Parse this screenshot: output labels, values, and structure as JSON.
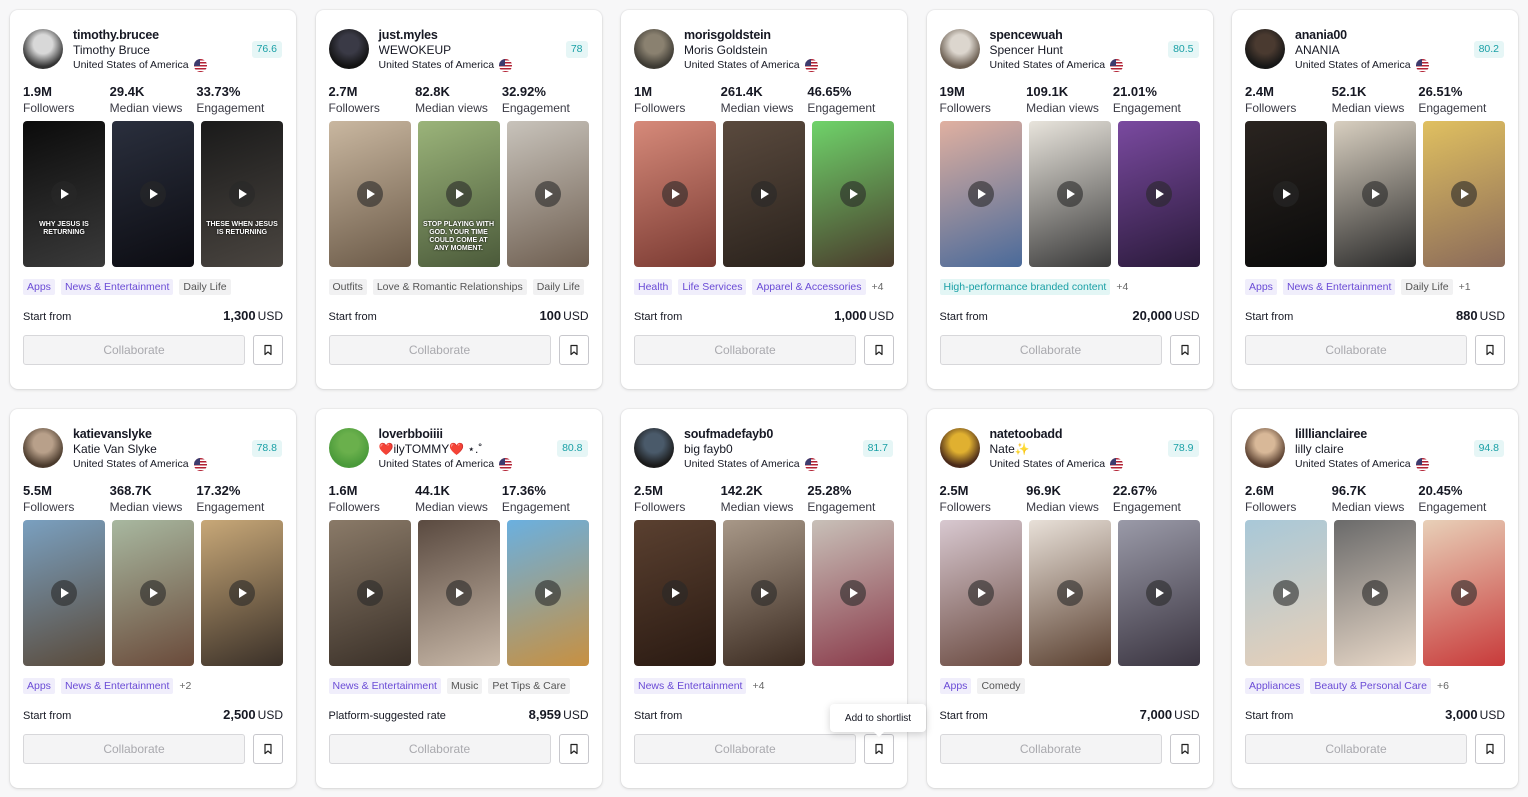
{
  "cards": [
    {
      "handle": "timothy.brucee",
      "display_name": "Timothy Bruce",
      "country": "United States of America",
      "score": "76.6",
      "followers": "1.9M",
      "median_views": "29.4K",
      "engagement": "33.73%",
      "followers_label": "Followers",
      "views_label": "Median views",
      "engagement_label": "Engagement",
      "tags": [
        {
          "text": "Apps",
          "style": "p"
        },
        {
          "text": "News & Entertainment",
          "style": "p"
        },
        {
          "text": "Daily Life",
          "style": "g"
        }
      ],
      "price_label": "Start from",
      "price": "1,300",
      "currency": "USD",
      "collaborate_label": "Collaborate",
      "avatar_colors": [
        "#d8d8d8",
        "#333333"
      ],
      "videos": [
        {
          "colors": [
            "#0b0b0b",
            "#3a3a3a"
          ],
          "caption": "WHY JESUS IS RETURNING"
        },
        {
          "colors": [
            "#2a2f3d",
            "#0c0c12"
          ],
          "caption": ""
        },
        {
          "colors": [
            "#1a1a1a",
            "#4a4540"
          ],
          "caption": "THESE WHEN JESUS IS RETURNING"
        }
      ]
    },
    {
      "handle": "just.myles",
      "display_name": "WEWOKEUP",
      "country": "United States of America",
      "score": "78",
      "followers": "2.7M",
      "median_views": "82.8K",
      "engagement": "32.92%",
      "followers_label": "Followers",
      "views_label": "Median views",
      "engagement_label": "Engagement",
      "tags": [
        {
          "text": "Outfits",
          "style": "g"
        },
        {
          "text": "Love & Romantic Relationships",
          "style": "g"
        },
        {
          "text": "Daily Life",
          "style": "g"
        }
      ],
      "price_label": "Start from",
      "price": "100",
      "currency": "USD",
      "collaborate_label": "Collaborate",
      "avatar_colors": [
        "#3a3a46",
        "#121212"
      ],
      "videos": [
        {
          "colors": [
            "#c9b7a0",
            "#6b5a48"
          ],
          "caption": ""
        },
        {
          "colors": [
            "#9bb47a",
            "#4b5a3a"
          ],
          "caption": "STOP PLAYING WITH GOD. YOUR TIME COULD COME AT ANY MOMENT."
        },
        {
          "colors": [
            "#c8c3bb",
            "#6e5e50"
          ],
          "caption": ""
        }
      ]
    },
    {
      "handle": "morisgoldstein",
      "display_name": "Moris  Goldstein",
      "country": "United States of America",
      "score": "",
      "followers": "1M",
      "median_views": "261.4K",
      "engagement": "46.65%",
      "followers_label": "Followers",
      "views_label": "Median views",
      "engagement_label": "Engagement",
      "tags": [
        {
          "text": "Health",
          "style": "p"
        },
        {
          "text": "Life Services",
          "style": "p"
        },
        {
          "text": "Apparel & Accessories",
          "style": "p"
        },
        {
          "text": "+4",
          "style": "more"
        }
      ],
      "price_label": "Start from",
      "price": "1,000",
      "currency": "USD",
      "collaborate_label": "Collaborate",
      "avatar_colors": [
        "#8a8170",
        "#3d3a33"
      ],
      "videos": [
        {
          "colors": [
            "#d68a7a",
            "#7a3a32"
          ],
          "caption": ""
        },
        {
          "colors": [
            "#5a4a3e",
            "#2a221c"
          ],
          "caption": ""
        },
        {
          "colors": [
            "#6fd36a",
            "#4a3a2c"
          ],
          "caption": ""
        }
      ]
    },
    {
      "handle": "spencewuah",
      "display_name": "Spencer Hunt",
      "country": "United States of America",
      "score": "80.5",
      "followers": "19M",
      "median_views": "109.1K",
      "engagement": "21.01%",
      "followers_label": "Followers",
      "views_label": "Median views",
      "engagement_label": "Engagement",
      "tags": [
        {
          "text": "High-performance branded content",
          "style": "t"
        },
        {
          "text": "+4",
          "style": "more"
        }
      ],
      "price_label": "Start from",
      "price": "20,000",
      "currency": "USD",
      "collaborate_label": "Collaborate",
      "avatar_colors": [
        "#dcd6ce",
        "#6a5d50"
      ],
      "videos": [
        {
          "colors": [
            "#e0b0a0",
            "#4a6a9a"
          ],
          "caption": ""
        },
        {
          "colors": [
            "#e8e4dc",
            "#3a3a3a"
          ],
          "caption": ""
        },
        {
          "colors": [
            "#7a4aa0",
            "#2a1a3a"
          ],
          "caption": ""
        }
      ]
    },
    {
      "handle": "anania00",
      "display_name": "ANANIA",
      "country": "United States of America",
      "score": "80.2",
      "followers": "2.4M",
      "median_views": "52.1K",
      "engagement": "26.51%",
      "followers_label": "Followers",
      "views_label": "Median views",
      "engagement_label": "Engagement",
      "tags": [
        {
          "text": "Apps",
          "style": "p"
        },
        {
          "text": "News & Entertainment",
          "style": "p"
        },
        {
          "text": "Daily Life",
          "style": "g"
        },
        {
          "text": "+1",
          "style": "more"
        }
      ],
      "price_label": "Start from",
      "price": "880",
      "currency": "USD",
      "collaborate_label": "Collaborate",
      "avatar_colors": [
        "#4a3a30",
        "#161616"
      ],
      "videos": [
        {
          "colors": [
            "#2a2420",
            "#0a0a0a"
          ],
          "caption": ""
        },
        {
          "colors": [
            "#d8cfc0",
            "#2a2a2a"
          ],
          "caption": ""
        },
        {
          "colors": [
            "#e0c060",
            "#8a6a5a"
          ],
          "caption": ""
        }
      ]
    },
    {
      "handle": "katievanslyke",
      "display_name": "Katie  Van  Slyke",
      "country": "United States of America",
      "score": "78.8",
      "followers": "5.5M",
      "median_views": "368.7K",
      "engagement": "17.32%",
      "followers_label": "Followers",
      "views_label": "Median views",
      "engagement_label": "Engagement",
      "tags": [
        {
          "text": "Apps",
          "style": "p"
        },
        {
          "text": "News & Entertainment",
          "style": "p"
        },
        {
          "text": "+2",
          "style": "more"
        }
      ],
      "price_label": "Start from",
      "price": "2,500",
      "currency": "USD",
      "collaborate_label": "Collaborate",
      "avatar_colors": [
        "#b8a08a",
        "#4a3a2c"
      ],
      "videos": [
        {
          "colors": [
            "#7aa0c0",
            "#5a4a3a"
          ],
          "caption": ""
        },
        {
          "colors": [
            "#a8b8a0",
            "#6a4a3a"
          ],
          "caption": ""
        },
        {
          "colors": [
            "#c8a878",
            "#3a3028"
          ],
          "caption": ""
        }
      ]
    },
    {
      "handle": "loverbboiiii",
      "display_name": "❤️ilyTOMMY❤️ ⋆.˚",
      "country": "United States of America",
      "score": "80.8",
      "followers": "1.6M",
      "median_views": "44.1K",
      "engagement": "17.36%",
      "followers_label": "Followers",
      "views_label": "Median views",
      "engagement_label": "Engagement",
      "tags": [
        {
          "text": "News & Entertainment",
          "style": "p"
        },
        {
          "text": "Music",
          "style": "g"
        },
        {
          "text": "Pet Tips & Care",
          "style": "g"
        }
      ],
      "price_label": "Platform-suggested rate",
      "price": "8,959",
      "currency": "USD",
      "collaborate_label": "Collaborate",
      "avatar_colors": [
        "#6ab04c",
        "#4a9a3a"
      ],
      "videos": [
        {
          "colors": [
            "#8a7a68",
            "#3a3028"
          ],
          "caption": ""
        },
        {
          "colors": [
            "#5a4a40",
            "#c8b8a8"
          ],
          "caption": ""
        },
        {
          "colors": [
            "#6ab0e0",
            "#c89040"
          ],
          "caption": ""
        }
      ]
    },
    {
      "handle": "soufmadefayb0",
      "display_name": "big fayb0",
      "country": "United States of America",
      "score": "81.7",
      "followers": "2.5M",
      "median_views": "142.2K",
      "engagement": "25.28%",
      "followers_label": "Followers",
      "views_label": "Median views",
      "engagement_label": "Engagement",
      "tags": [
        {
          "text": "News & Entertainment",
          "style": "p"
        },
        {
          "text": "+4",
          "style": "more"
        }
      ],
      "price_label": "Start from",
      "price": "",
      "currency": "",
      "collaborate_label": "Collaborate",
      "avatar_colors": [
        "#4a5a6a",
        "#1a1a1a"
      ],
      "videos": [
        {
          "colors": [
            "#5a4030",
            "#2a1a12"
          ],
          "caption": ""
        },
        {
          "colors": [
            "#a89888",
            "#3a2a20"
          ],
          "caption": ""
        },
        {
          "colors": [
            "#c8c0b8",
            "#8a3a4a"
          ],
          "caption": ""
        }
      ]
    },
    {
      "handle": "natetoobadd",
      "display_name": "Nate✨",
      "country": "United States of America",
      "score": "78.9",
      "followers": "2.5M",
      "median_views": "96.9K",
      "engagement": "22.67%",
      "followers_label": "Followers",
      "views_label": "Median views",
      "engagement_label": "Engagement",
      "tags": [
        {
          "text": "Apps",
          "style": "p"
        },
        {
          "text": "Comedy",
          "style": "g"
        }
      ],
      "price_label": "Start from",
      "price": "7,000",
      "currency": "USD",
      "collaborate_label": "Collaborate",
      "avatar_colors": [
        "#e0b030",
        "#4a2a1a"
      ],
      "videos": [
        {
          "colors": [
            "#d8c8d0",
            "#6a4a40"
          ],
          "caption": ""
        },
        {
          "colors": [
            "#e8e0d8",
            "#5a4030"
          ],
          "caption": ""
        },
        {
          "colors": [
            "#9a9aa8",
            "#3a3440"
          ],
          "caption": ""
        }
      ]
    },
    {
      "handle": "lilllianclairee",
      "display_name": "lilly claire",
      "country": "United States of America",
      "score": "94.8",
      "followers": "2.6M",
      "median_views": "96.7K",
      "engagement": "20.45%",
      "followers_label": "Followers",
      "views_label": "Median views",
      "engagement_label": "Engagement",
      "tags": [
        {
          "text": "Appliances",
          "style": "p"
        },
        {
          "text": "Beauty & Personal Care",
          "style": "p"
        },
        {
          "text": "+6",
          "style": "more"
        }
      ],
      "price_label": "Start from",
      "price": "3,000",
      "currency": "USD",
      "collaborate_label": "Collaborate",
      "avatar_colors": [
        "#d8b898",
        "#5a4030"
      ],
      "videos": [
        {
          "colors": [
            "#a8c8d8",
            "#e8d0b8"
          ],
          "caption": ""
        },
        {
          "colors": [
            "#6a6a6a",
            "#e8d8c8"
          ],
          "caption": ""
        },
        {
          "colors": [
            "#e8d0b8",
            "#c83a3a"
          ],
          "caption": ""
        }
      ]
    }
  ],
  "tooltip": "Add to shortlist"
}
